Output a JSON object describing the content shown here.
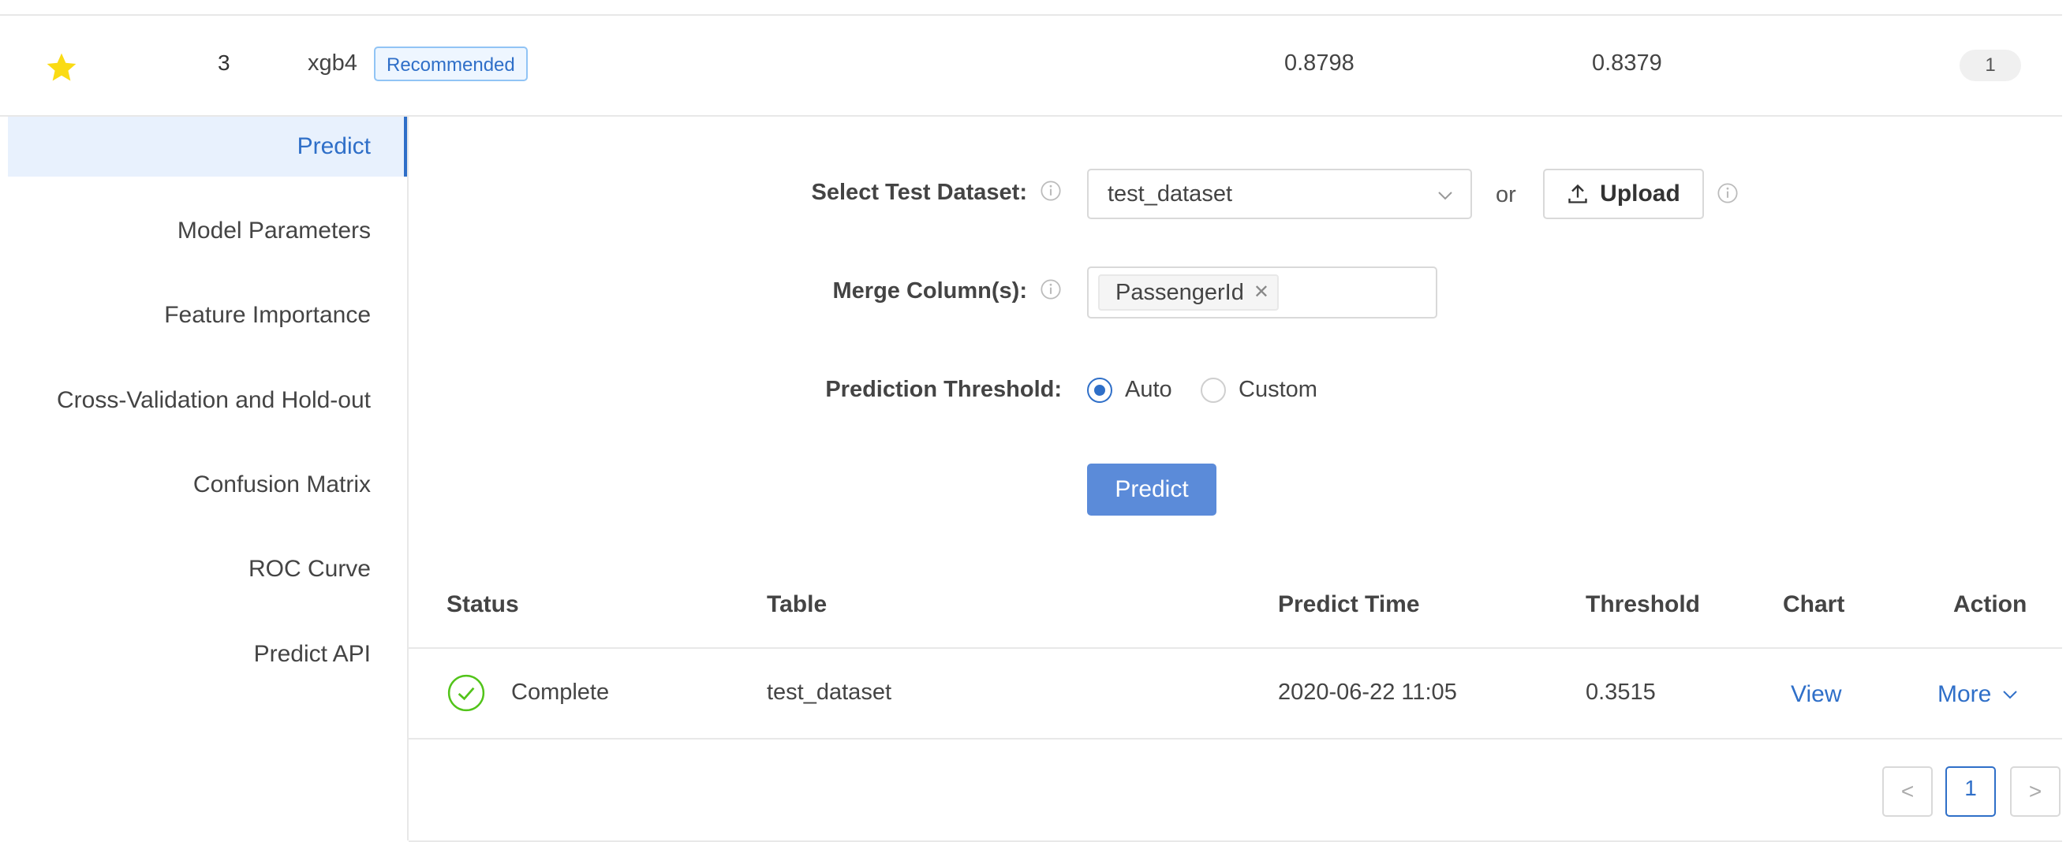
{
  "model_row": {
    "rank": "3",
    "name": "xgb4",
    "tag": "Recommended",
    "metric_1": "0.8798",
    "metric_2": "0.8379",
    "count": "1",
    "starred": true,
    "star_color": "#fadb14"
  },
  "menu": {
    "items": [
      {
        "label": "Predict",
        "active": true
      },
      {
        "label": "Model Parameters"
      },
      {
        "label": "Feature Importance"
      },
      {
        "label": "Cross-Validation and Hold-out"
      },
      {
        "label": "Confusion Matrix"
      },
      {
        "label": "ROC Curve"
      },
      {
        "label": "Predict API"
      }
    ]
  },
  "form": {
    "dataset_label": "Select Test Dataset:",
    "dataset_value": "test_dataset",
    "or_text": "or",
    "upload_label": "Upload",
    "merge_label": "Merge Column(s):",
    "merge_tag": "PassengerId",
    "threshold_label": "Prediction Threshold:",
    "threshold_options": [
      {
        "label": "Auto",
        "checked": true
      },
      {
        "label": "Custom",
        "checked": false
      }
    ],
    "predict_label": "Predict"
  },
  "table": {
    "headers": [
      "Status",
      "Table",
      "Predict Time",
      "Threshold",
      "Chart",
      "Action"
    ],
    "rows": [
      {
        "status": "Complete",
        "table": "test_dataset",
        "predict_time": "2020-06-22 11:05",
        "threshold": "0.3515",
        "chart": "View",
        "action": "More"
      }
    ]
  },
  "pagination": {
    "prev": "<",
    "current": "1",
    "next": ">"
  },
  "colors": {
    "accent": "#2f6fc8",
    "button_primary": "#5b8bd9",
    "success": "#52c41a",
    "tag_bg": "#eef6ff"
  }
}
